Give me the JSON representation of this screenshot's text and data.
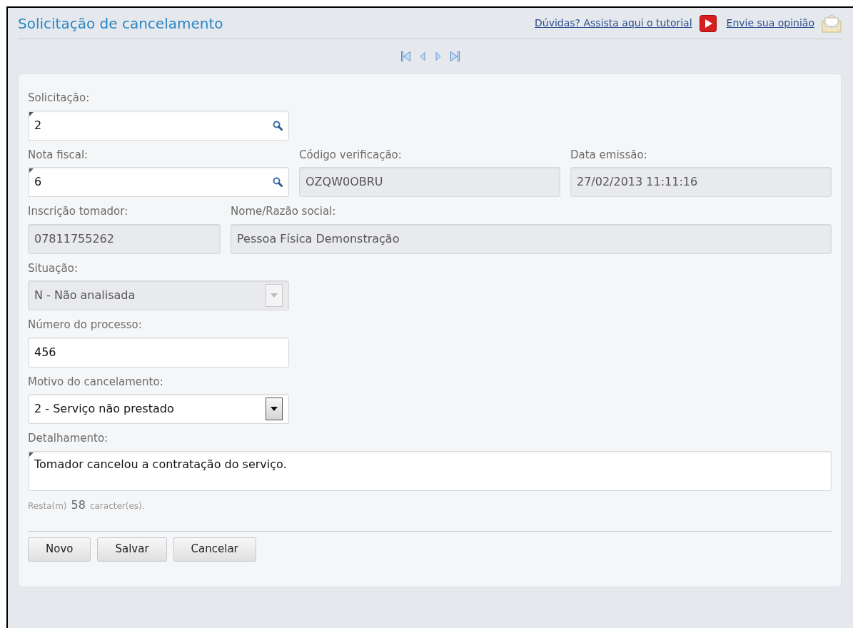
{
  "window": {
    "title": "Solicitação de cancelamento"
  },
  "header_links": [
    {
      "label": "Dúvidas? Assista aqui o tutorial",
      "kind": "video"
    },
    {
      "label": "Envie sua opinião",
      "kind": "mail"
    }
  ],
  "form": {
    "rows": [
      [
        {
          "label": "Solicitação:",
          "kind": "lookup",
          "value": "2",
          "required": true,
          "disabled": false
        }
      ],
      [
        {
          "label": "Nota fiscal:",
          "kind": "lookup",
          "value": "6",
          "required": true,
          "disabled": false
        },
        {
          "label": "Código verificação:",
          "kind": "text",
          "value": "OZQW0OBRU",
          "required": false,
          "disabled": true
        },
        {
          "label": "Data emissão:",
          "kind": "text",
          "value": "27/02/2013 11:11:16",
          "required": false,
          "disabled": true
        }
      ],
      [
        {
          "label": "Inscrição tomador:",
          "kind": "text",
          "value": "07811755262",
          "required": false,
          "disabled": true
        },
        {
          "label": "Nome/Razão social:",
          "kind": "text",
          "value": "Pessoa Física Demonstração",
          "required": false,
          "disabled": true
        }
      ],
      [
        {
          "label": "Situação:",
          "kind": "select",
          "value": "N - Não analisada",
          "required": false,
          "disabled": true
        }
      ],
      [
        {
          "label": "Número do processo:",
          "kind": "text",
          "value": "456",
          "required": false,
          "disabled": false
        }
      ],
      [
        {
          "label": "Motivo do cancelamento:",
          "kind": "select",
          "value": "2 - Serviço não prestado",
          "required": false,
          "disabled": false
        }
      ],
      [
        {
          "label": "Detalhamento:",
          "kind": "textarea",
          "value": "Tomador cancelou a contratação do serviço.",
          "required": true,
          "disabled": false
        }
      ]
    ],
    "counter": {
      "prefix": "Resta(m)",
      "count": "58",
      "suffix": "caracter(es)."
    },
    "buttons": [
      "Novo",
      "Salvar",
      "Cancelar"
    ]
  }
}
